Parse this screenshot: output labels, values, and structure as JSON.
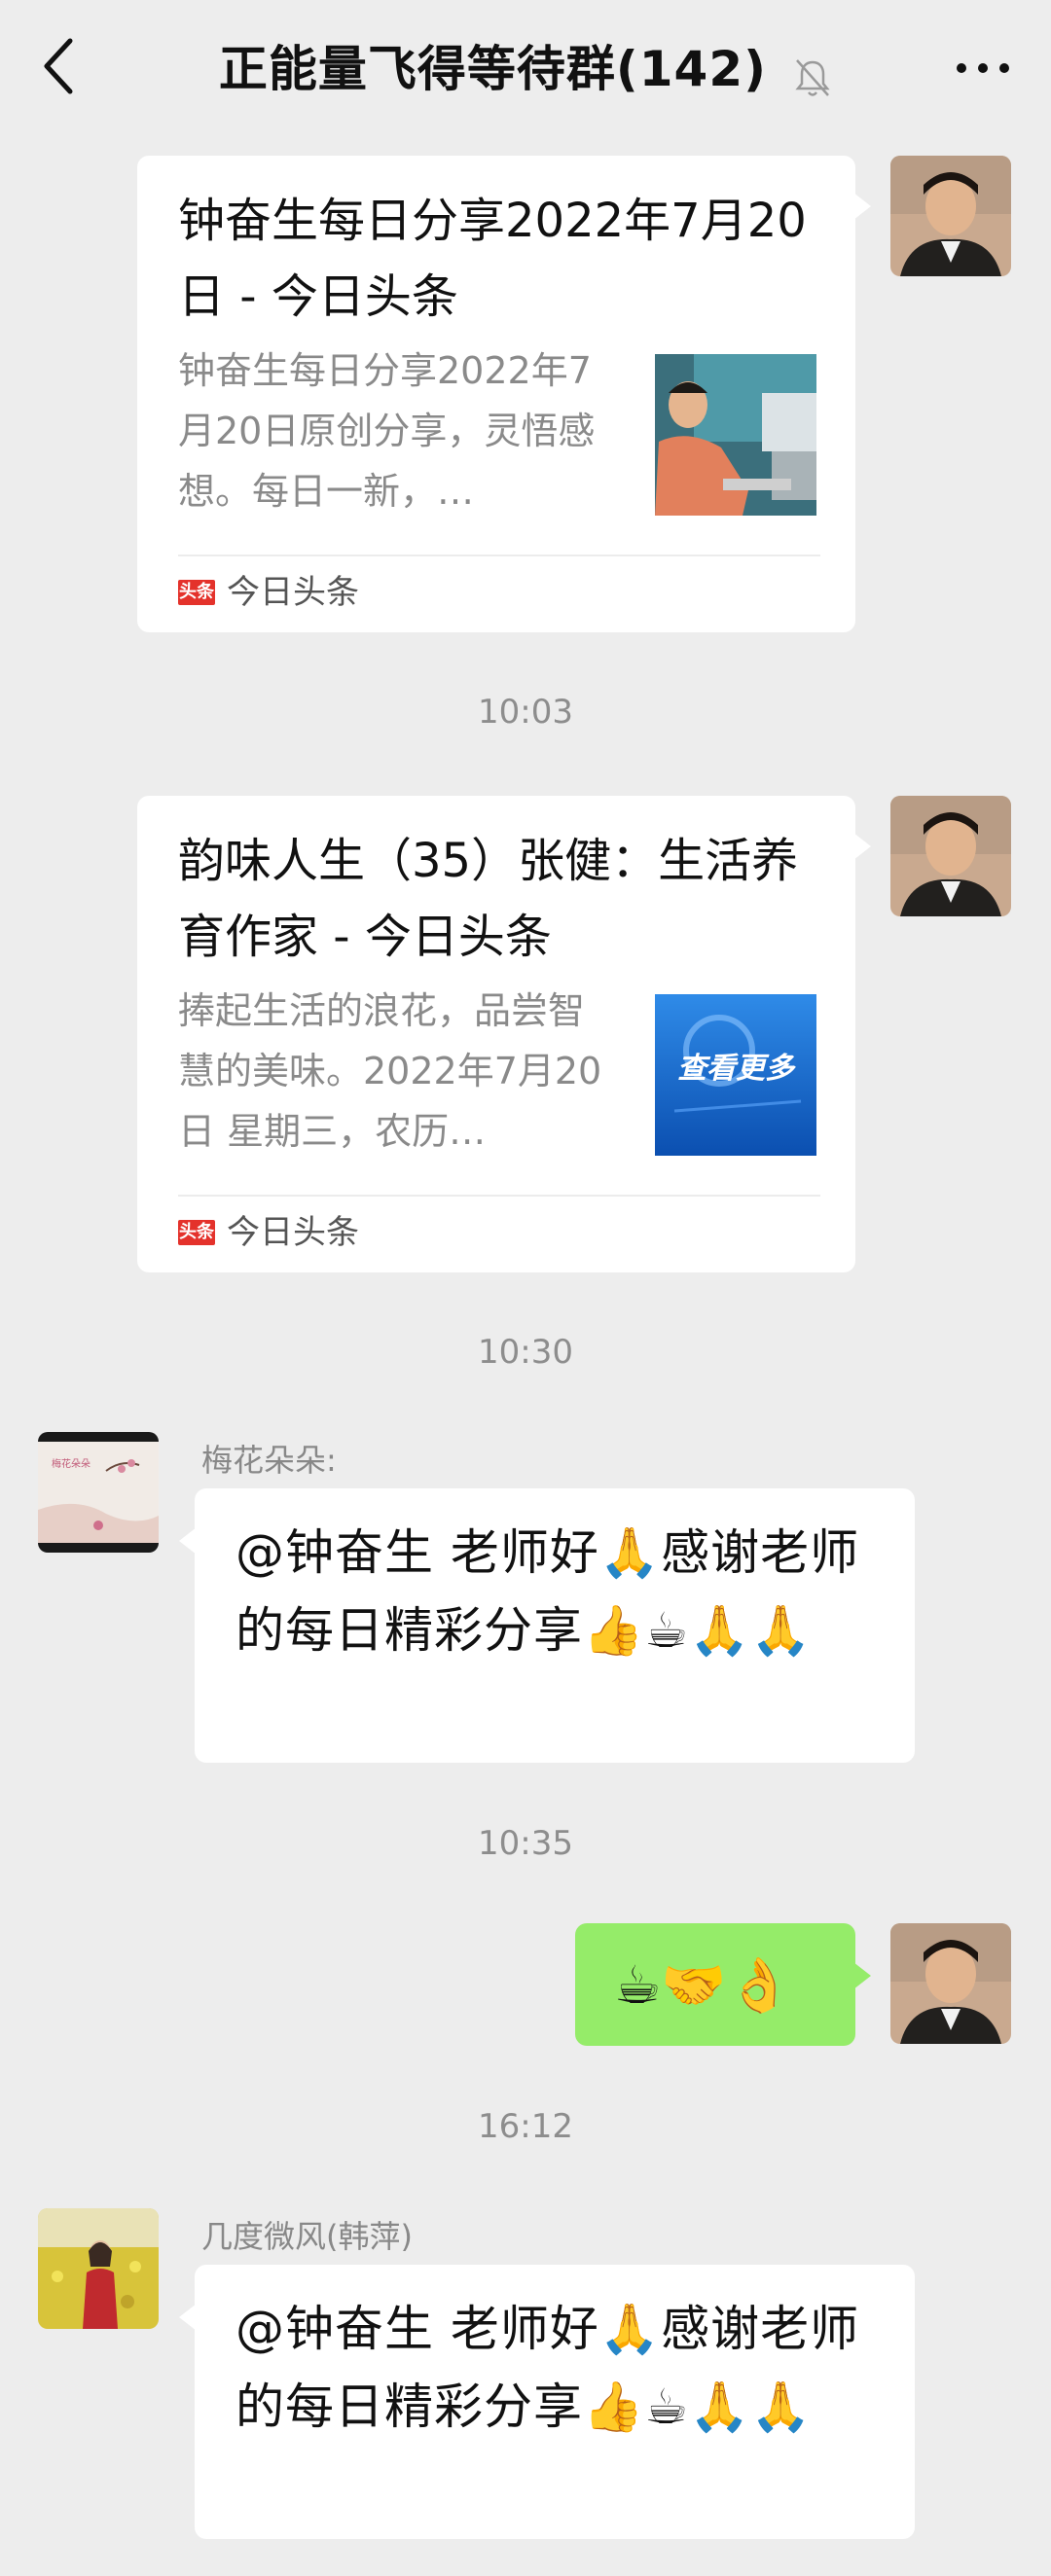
{
  "header": {
    "title": "正能量飞得等待群(142)",
    "back_icon": "chevron-left-icon",
    "mute_icon": "bell-muted-icon",
    "more_icon": "ellipsis-icon"
  },
  "messages": [
    {
      "type": "link_card",
      "side": "right",
      "title": "钟奋生每日分享2022年7月20日 - 今日头条",
      "description": "钟奋生每日分享2022年7月20日原创分享，灵悟感想。每日一新，…",
      "source": "今日头条",
      "source_icon": "头条"
    },
    {
      "type": "timestamp",
      "text": "10:03"
    },
    {
      "type": "link_card",
      "side": "right",
      "title": "韵味人生（35）张健：生活养育作家 - 今日头条",
      "description": "捧起生活的浪花，品尝智慧的美味。2022年7月20日 星期三，农历…",
      "thumb_text": "查看更多",
      "source": "今日头条",
      "source_icon": "头条"
    },
    {
      "type": "timestamp",
      "text": "10:30"
    },
    {
      "type": "text",
      "side": "left",
      "sender": "梅花朵朵:",
      "avatar_text": "梅花朵朵",
      "text": "@钟奋生  老师好🙏感谢老师的每日精彩分享👍☕🙏🙏"
    },
    {
      "type": "timestamp",
      "text": "10:35"
    },
    {
      "type": "emoji",
      "side": "right",
      "text": "☕🤝👌"
    },
    {
      "type": "timestamp",
      "text": "16:12"
    },
    {
      "type": "text",
      "side": "left",
      "sender": "几度微风(韩萍)",
      "text": "@钟奋生  老师好🙏感谢老师的每日精彩分享👍☕🙏🙏"
    }
  ]
}
